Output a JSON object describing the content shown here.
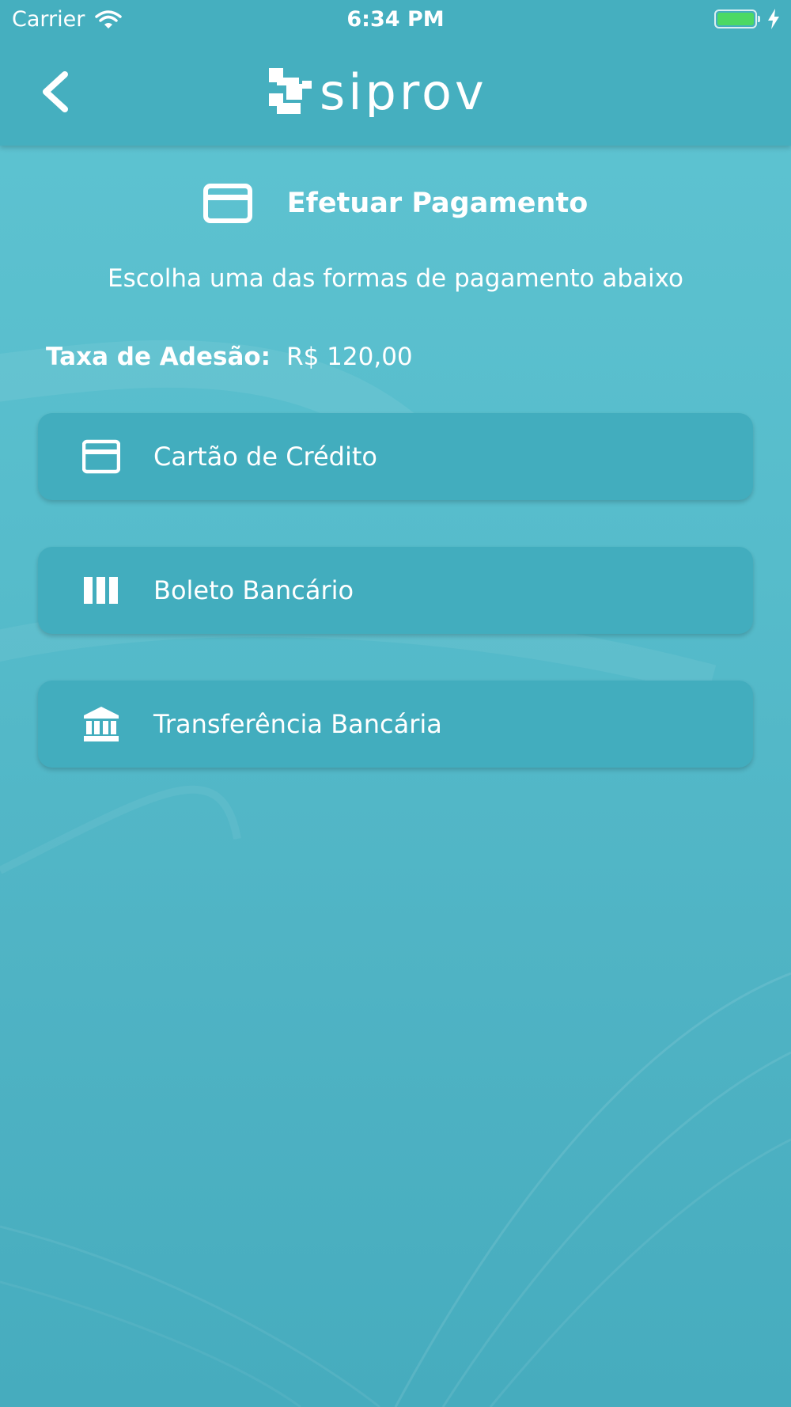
{
  "status_bar": {
    "carrier": "Carrier",
    "time": "6:34 PM",
    "battery_color": "#4cd964"
  },
  "header": {
    "logo_text": "siprov",
    "back_icon": "chevron-left-icon"
  },
  "page": {
    "title": "Efetuar Pagamento",
    "title_icon": "credit-card-icon",
    "subtitle": "Escolha uma das formas de pagamento abaixo",
    "fee_label": "Taxa de Adesão:",
    "fee_value": "R$ 120,00"
  },
  "payment_options": [
    {
      "label": "Cartão de Crédito",
      "icon": "credit-card-icon"
    },
    {
      "label": "Boleto Bancário",
      "icon": "barcode-icon"
    },
    {
      "label": "Transferência Bancária",
      "icon": "bank-icon"
    }
  ],
  "colors": {
    "header": "#45afbf",
    "button": "#42adbe",
    "background": "#56bccb"
  }
}
